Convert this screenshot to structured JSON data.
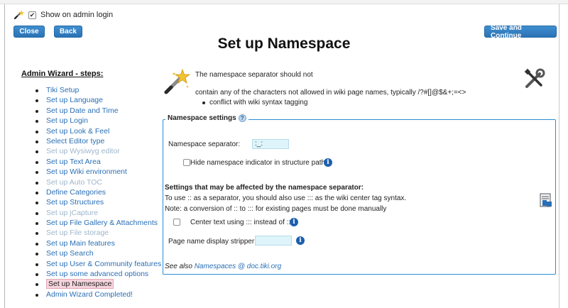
{
  "topbar": {
    "show_on_admin_login": "Show on admin login",
    "checkbox_mark": "✔"
  },
  "buttons": {
    "close": "Close",
    "back": "Back",
    "save": "Save and Continue"
  },
  "page_title": "Set up Namespace",
  "steps": {
    "heading": "Admin Wizard - steps:",
    "items": [
      {
        "label": "Tiki Setup",
        "state": "link"
      },
      {
        "label": "Set up Language",
        "state": "link"
      },
      {
        "label": "Set up Date and Time",
        "state": "link"
      },
      {
        "label": "Set up Login",
        "state": "link"
      },
      {
        "label": "Set up Look & Feel",
        "state": "link"
      },
      {
        "label": "Select Editor type",
        "state": "link"
      },
      {
        "label": "Set up Wysiwyg editor",
        "state": "disabled"
      },
      {
        "label": "Set up Text Area",
        "state": "link"
      },
      {
        "label": "Set up Wiki environment",
        "state": "link"
      },
      {
        "label": "Set up Auto TOC",
        "state": "disabled"
      },
      {
        "label": "Define Categories",
        "state": "link"
      },
      {
        "label": "Set up Structures",
        "state": "link"
      },
      {
        "label": "Set up jCapture",
        "state": "disabled"
      },
      {
        "label": "Set up File Gallery & Attachments",
        "state": "link"
      },
      {
        "label": "Set up File storage",
        "state": "disabled"
      },
      {
        "label": "Set up Main features",
        "state": "link"
      },
      {
        "label": "Set up Search",
        "state": "link"
      },
      {
        "label": "Set up User & Community features",
        "state": "link"
      },
      {
        "label": "Set up some advanced options",
        "state": "link"
      },
      {
        "label": "Set up Namespace",
        "state": "current"
      },
      {
        "label": "Admin Wizard Completed!",
        "state": "link"
      }
    ]
  },
  "intro": {
    "line1": "The namespace separator should not",
    "line2": "contain any of the characters not allowed in wiki page names, typically /?#[]@$&+;=<>",
    "line3": "conflict with wiki syntax tagging"
  },
  "settings": {
    "legend": "Namespace settings",
    "separator_label": "Namespace separator:",
    "separator_value": ":_:",
    "hide_indicator_label": "Hide namespace indicator in structure path",
    "affected_heading": "Settings that may be affected by the namespace separator:",
    "affected_line1": "To use :: as a separator, you should also use ::: as the wiki center tag syntax.",
    "affected_line2": "Note: a conversion of :: to ::: for existing pages must be done manually",
    "center_text_label": "Center text using ::: instead of ::",
    "stripper_label": "Page name display stripper:",
    "stripper_value": "",
    "see_also_prefix": "See also ",
    "see_also_link": "Namespaces @ doc.tiki.org"
  },
  "icons": {
    "info_glyph": "i",
    "help_glyph": "?"
  }
}
